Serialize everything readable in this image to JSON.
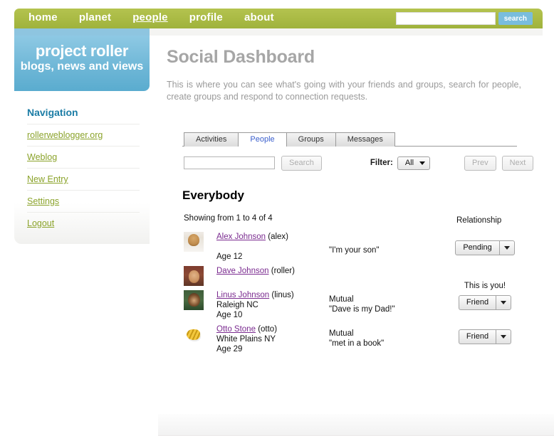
{
  "header": {
    "nav": [
      {
        "label": "home",
        "active": false
      },
      {
        "label": "planet",
        "active": false
      },
      {
        "label": "people",
        "active": true
      },
      {
        "label": "profile",
        "active": false
      },
      {
        "label": "about",
        "active": false
      }
    ],
    "search_value": "",
    "search_placeholder": "",
    "search_button": "search"
  },
  "sidebar": {
    "brand_title": "project roller",
    "brand_sub": "blogs, news and views",
    "nav_title": "Navigation",
    "items": [
      {
        "label": "rollerweblogger.org"
      },
      {
        "label": "Weblog"
      },
      {
        "label": "New Entry"
      },
      {
        "label": "Settings"
      },
      {
        "label": "Logout"
      }
    ]
  },
  "main": {
    "title": "Social Dashboard",
    "description": "This is where you can see what's going with your friends and groups, search for people, create groups and respond to connection requests.",
    "tabs": [
      {
        "label": "Activities",
        "active": false
      },
      {
        "label": "People",
        "active": true
      },
      {
        "label": "Groups",
        "active": false
      },
      {
        "label": "Messages",
        "active": false
      }
    ],
    "toolbar": {
      "search_value": "",
      "search_placeholder": "",
      "search_button": "Search",
      "filter_label": "Filter:",
      "filter_value": "All",
      "filter_options": [
        "All"
      ],
      "prev_button": "Prev",
      "next_button": "Next"
    },
    "section_title": "Everybody",
    "showing_text": "Showing from 1 to 4 of 4",
    "relationship_header": "Relationship",
    "people": [
      {
        "name": "Alex Johnson",
        "username": "(alex)",
        "location": "",
        "age": "Age 12",
        "relationship": "",
        "quote": "\"I'm your son\"",
        "action_label": "Pending",
        "action_type": "splitbutton",
        "avatar": "av-alex"
      },
      {
        "name": "Dave Johnson",
        "username": "(roller)",
        "location": "",
        "age": "",
        "relationship": "",
        "quote": "",
        "action_label": "This is you!",
        "action_type": "text",
        "avatar": "av-dave"
      },
      {
        "name": "Linus Johnson",
        "username": "(linus)",
        "location": "Raleigh NC",
        "age": "Age 10",
        "relationship": "Mutual",
        "quote": "\"Dave is my Dad!\"",
        "action_label": "Friend",
        "action_type": "splitbutton",
        "avatar": "av-linus"
      },
      {
        "name": "Otto Stone",
        "username": "(otto)",
        "location": "White Plains NY",
        "age": "Age 29",
        "relationship": "Mutual",
        "quote": "\"met in a book\"",
        "action_label": "Friend",
        "action_type": "splitbutton",
        "avatar": "av-otto"
      }
    ]
  },
  "colors": {
    "nav_green": "#a9ba44",
    "brand_blue": "#6db6d6",
    "link_green": "#8ba32b",
    "heading_blue": "#1b7ca5",
    "title_gray": "#a6a6a6",
    "visited_link": "#7a2a8f",
    "active_tab_text": "#3a5fcd",
    "search_button_blue": "#79bddd"
  }
}
